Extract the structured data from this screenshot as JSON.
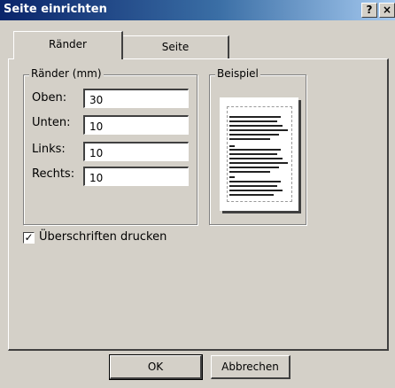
{
  "window": {
    "title": "Seite einrichten",
    "help_label": "?",
    "close_label": "×"
  },
  "tabs": [
    {
      "label": "Ränder",
      "active": true
    },
    {
      "label": "Seite",
      "active": false
    }
  ],
  "margins_group": {
    "legend": "Ränder (mm)",
    "fields": [
      {
        "label": "Oben:",
        "value": "30"
      },
      {
        "label": "Unten:",
        "value": "10"
      },
      {
        "label": "Links:",
        "value": "10"
      },
      {
        "label": "Rechts:",
        "value": "10"
      }
    ]
  },
  "example_group": {
    "legend": "Beispiel"
  },
  "headers_checkbox": {
    "label": "Überschriften drucken",
    "checked": true,
    "mark": "✓"
  },
  "buttons": {
    "ok": "OK",
    "cancel": "Abbrechen"
  }
}
